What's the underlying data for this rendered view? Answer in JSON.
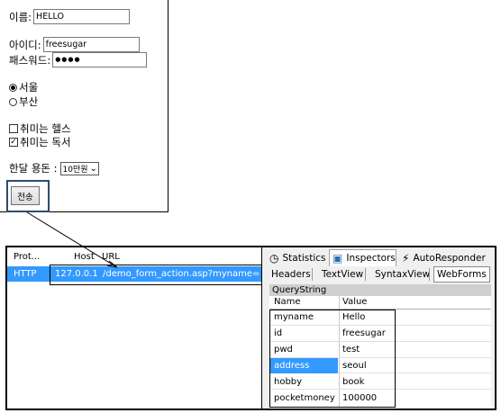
{
  "form": {
    "name_label": "이름:",
    "name_value": "HELLO",
    "id_label": "아이디:",
    "id_value": "freesugar",
    "pwd_label": "패스워드:",
    "pwd_value": "●●●●",
    "address_options": [
      {
        "label": "서울",
        "selected": true
      },
      {
        "label": "부산",
        "selected": false
      }
    ],
    "hobby_options": [
      {
        "label": "취미는 헬스",
        "checked": false
      },
      {
        "label": "취미는 독서",
        "checked": true
      }
    ],
    "checkmark": "✓",
    "money_label": "한달 용돈 :",
    "money_value": "10만원",
    "submit_label": "전송"
  },
  "sessions": {
    "headers": [
      "Prot...",
      "Host",
      "URL"
    ],
    "row": {
      "protocol": "HTTP",
      "host": "127.0.0.1",
      "url": "/demo_form_action.asp?myname=Hello&"
    }
  },
  "inspector": {
    "tabs": [
      {
        "label": "Statistics",
        "icon": "clock-icon"
      },
      {
        "label": "Inspectors",
        "icon": "inspect-icon",
        "active": true
      },
      {
        "label": "AutoResponder",
        "icon": "lightning-icon"
      }
    ],
    "subtabs": [
      "Headers",
      "TextView",
      "SyntaxView",
      "WebForms"
    ],
    "active_subtab": "WebForms",
    "section_title": "QueryString",
    "columns": [
      "Name",
      "Value"
    ],
    "rows": [
      {
        "name": "myname",
        "value": "Hello"
      },
      {
        "name": "id",
        "value": "freesugar"
      },
      {
        "name": "pwd",
        "value": "test"
      },
      {
        "name": "address",
        "value": "seoul",
        "selected": true
      },
      {
        "name": "hobby",
        "value": "book"
      },
      {
        "name": "pocketmoney",
        "value": "100000"
      }
    ]
  },
  "colors": {
    "selection": "#3399ff",
    "highlight_border": "#2b4d6e"
  }
}
